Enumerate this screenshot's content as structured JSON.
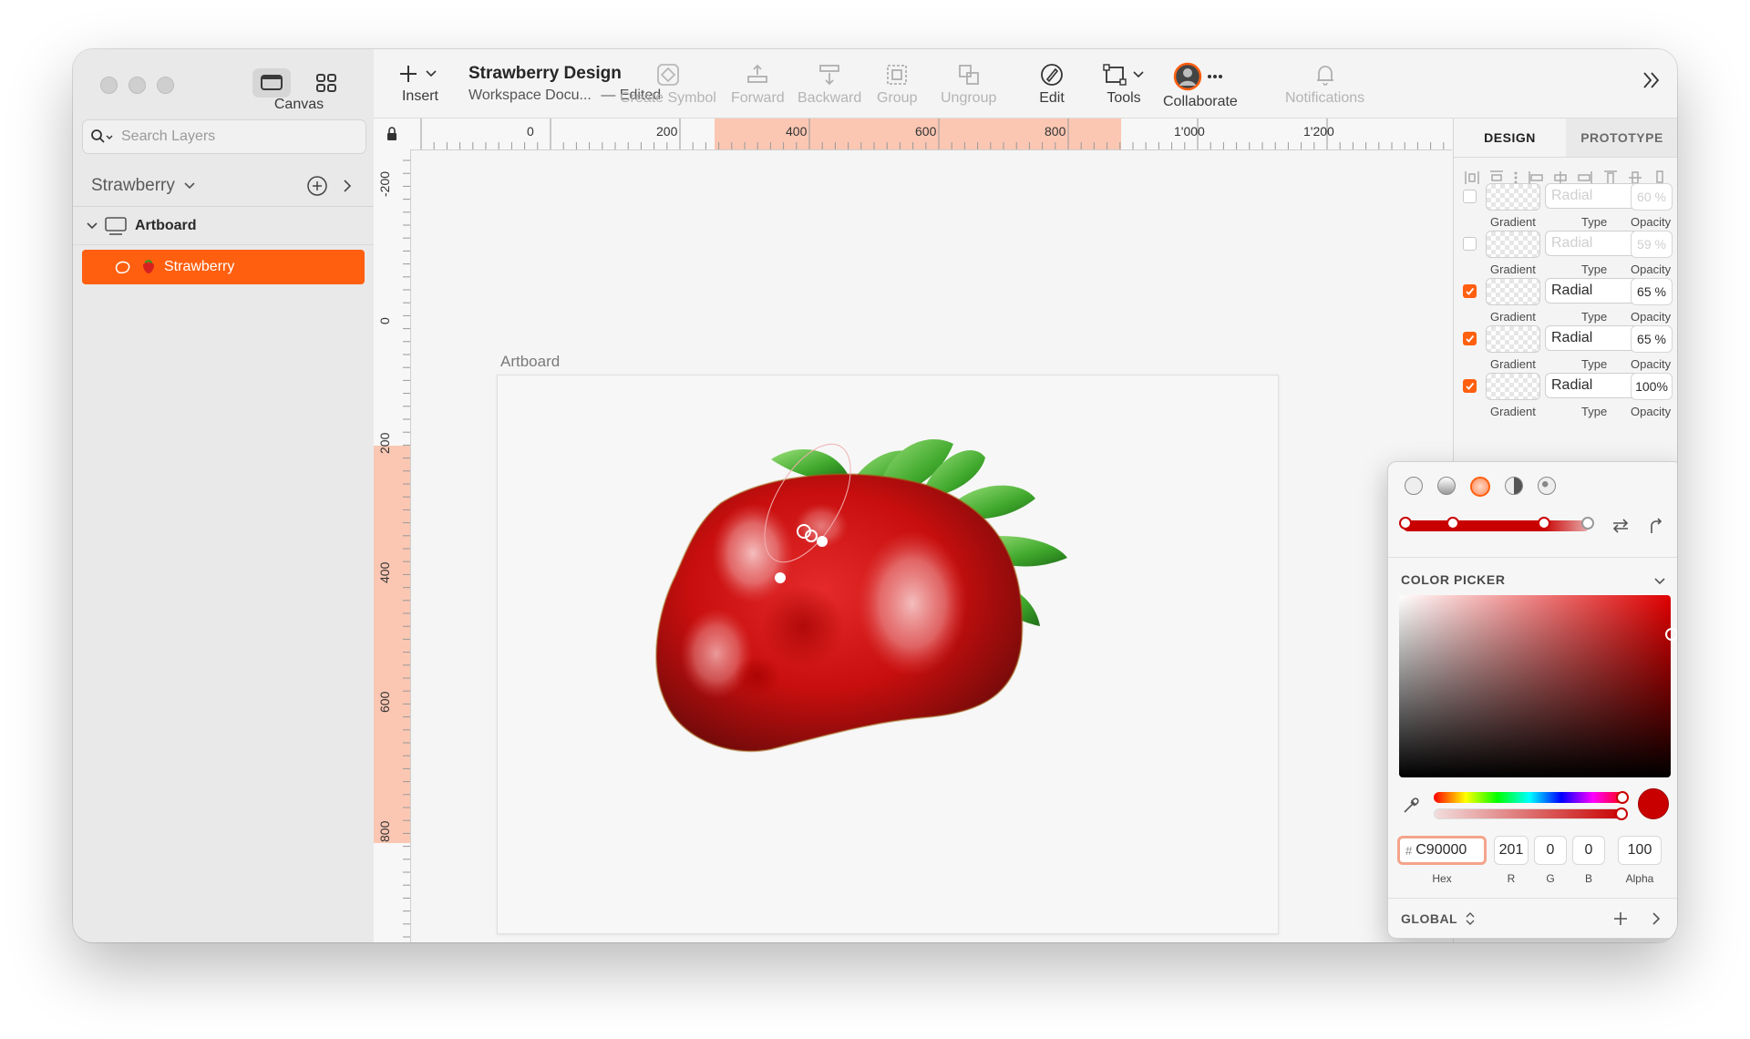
{
  "sidebar": {
    "canvas_label": "Canvas",
    "search_placeholder": "Search Layers",
    "page_name": "Strawberry",
    "artboard_layer": "Artboard",
    "selected_layer": "Strawberry"
  },
  "toolbar": {
    "insert": "Insert",
    "doc_title": "Strawberry Design",
    "doc_location": "Workspace Docu...",
    "doc_status": "— Edited",
    "create_symbol": "Create Symbol",
    "forward": "Forward",
    "backward": "Backward",
    "group": "Group",
    "ungroup": "Ungroup",
    "edit": "Edit",
    "tools": "Tools",
    "collaborate": "Collaborate",
    "notifications": "Notifications"
  },
  "rulers": {
    "top": [
      "0",
      "200",
      "400",
      "600",
      "800",
      "1'000",
      "1'200"
    ],
    "left": [
      "-200",
      "0",
      "200",
      "400",
      "600",
      "800"
    ]
  },
  "canvas": {
    "artboard_label": "Artboard"
  },
  "inspector": {
    "tabs": [
      "DESIGN",
      "PROTOTYPE"
    ],
    "fills": [
      {
        "enabled": false,
        "type": "Radial",
        "opacity": "60 %",
        "labels": [
          "Gradient",
          "Type",
          "Opacity"
        ]
      },
      {
        "enabled": false,
        "type": "Radial",
        "opacity": "59 %",
        "labels": [
          "Gradient",
          "Type",
          "Opacity"
        ]
      },
      {
        "enabled": true,
        "type": "Radial",
        "opacity": "65 %",
        "labels": [
          "Gradient",
          "Type",
          "Opacity"
        ]
      },
      {
        "enabled": true,
        "type": "Radial",
        "opacity": "65 %",
        "labels": [
          "Gradient",
          "Type",
          "Opacity"
        ]
      },
      {
        "enabled": true,
        "type": "Radial",
        "opacity": "100%",
        "labels": [
          "Gradient",
          "Type",
          "Opacity"
        ]
      }
    ]
  },
  "color_picker": {
    "title": "COLOR PICKER",
    "hex_prefix": "#",
    "hex": "C90000",
    "r": "201",
    "g": "0",
    "b": "0",
    "alpha": "100",
    "labels": {
      "hex": "Hex",
      "r": "R",
      "g": "G",
      "b": "B",
      "alpha": "Alpha"
    },
    "global": "GLOBAL",
    "current_color": "#c90000",
    "accent": "#ff5f0f"
  }
}
